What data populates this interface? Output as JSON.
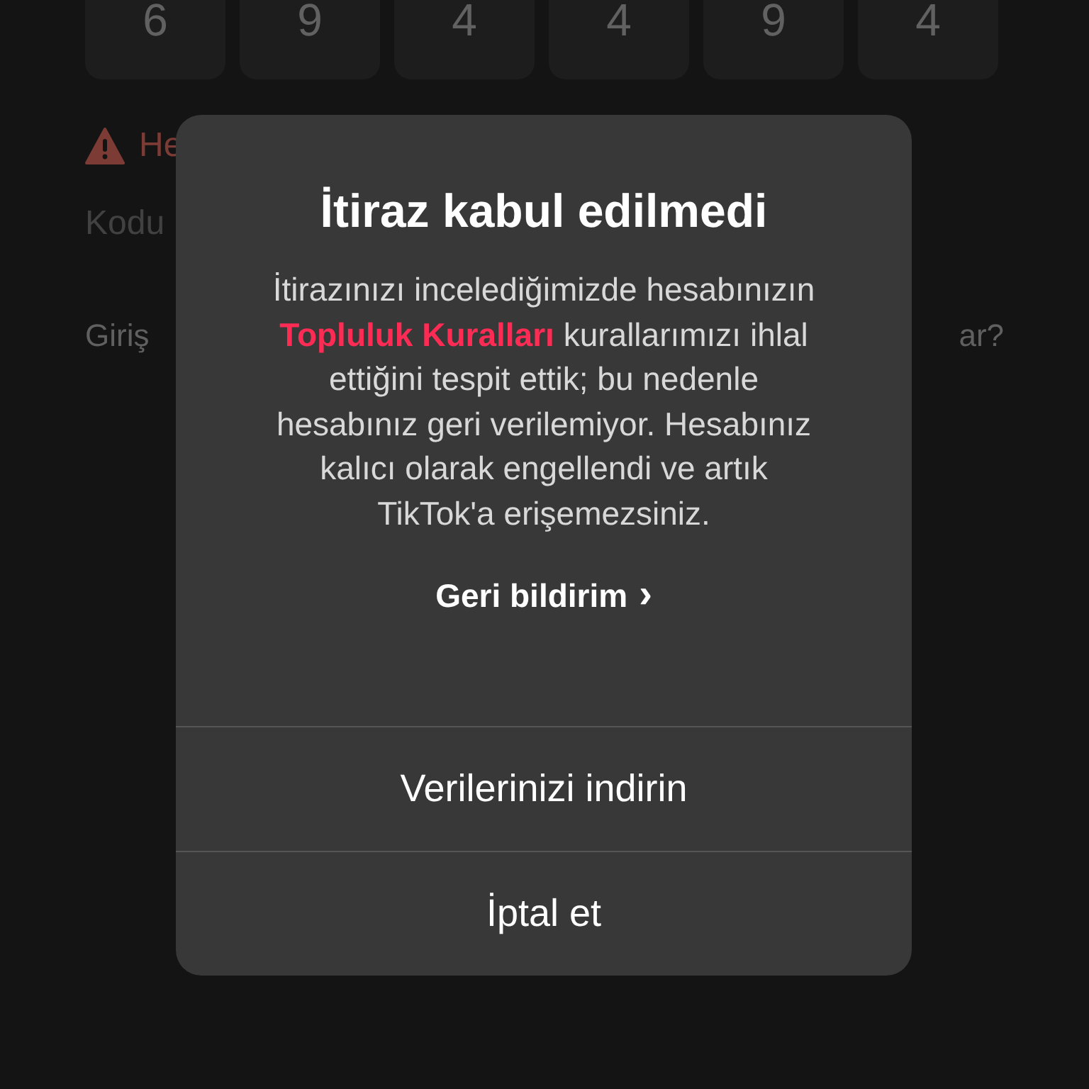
{
  "code_digits": [
    "6",
    "9",
    "4",
    "4",
    "9",
    "4"
  ],
  "background": {
    "warning": "He",
    "code_hint": "Kodu",
    "login_prompt": "Giriş",
    "login_prompt_end": "ar?"
  },
  "dialog": {
    "title": "İtiraz kabul edilmedi",
    "message": {
      "before": "İtirazınızı incelediğimizde hesabınızın",
      "link": "Topluluk Kuralları",
      "after": "kurallarımızı ihlal ettiğini tespit ettik; bu nedenle hesabınız geri verilemiyor. Hesabınız kalıcı olarak engellendi ve artık TikTok'a erişemezsiniz."
    },
    "feedback_link": "Geri bildirim",
    "feedback_chevron": "›",
    "actions": [
      "Verilerinizi indirin",
      "İptal et"
    ]
  }
}
